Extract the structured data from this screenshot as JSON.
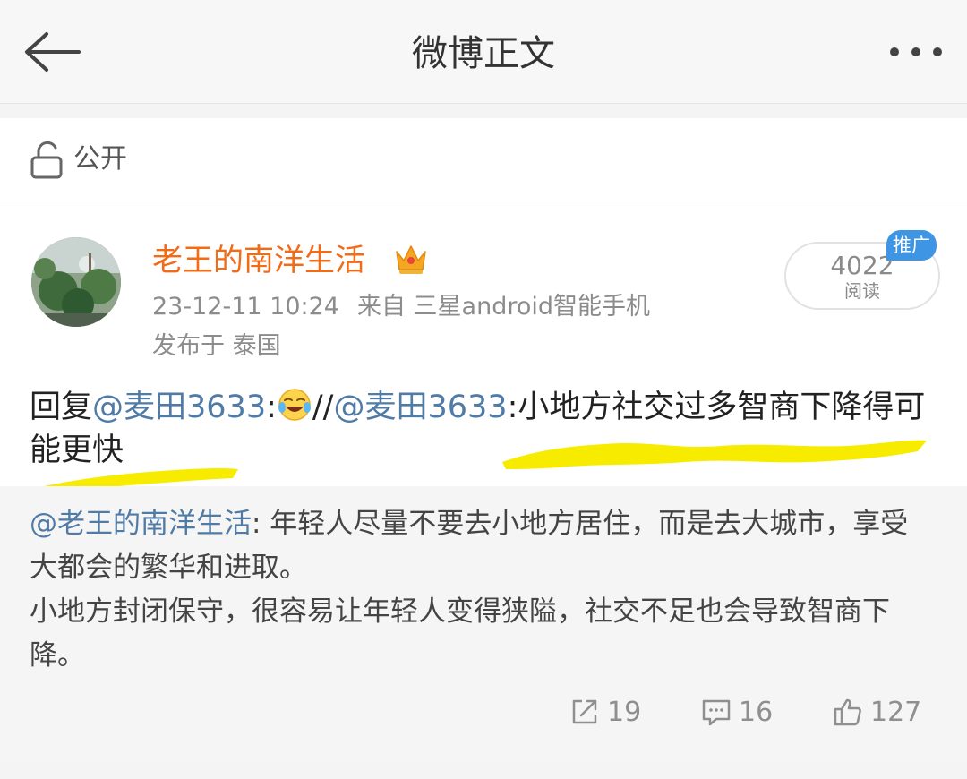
{
  "header": {
    "title": "微博正文",
    "back_icon": "back-arrow-icon",
    "more_icon": "more-dots-icon"
  },
  "privacy": {
    "icon": "lock-icon",
    "label": "公开"
  },
  "post": {
    "author": "老王的南洋生活",
    "author_badge_icon": "crown-icon",
    "author_color": "#f26b16",
    "timestamp": "23-12-11 10:24",
    "source": "来自 三星android智能手机",
    "location": "发布于 泰国",
    "read_count": "4022",
    "read_label": "阅读",
    "ad_badge": "推广",
    "text": {
      "prefix": "回复",
      "mention_1": "@麦田3633",
      "sep_1": ":",
      "emoji": "laughing-crying-emoji",
      "sep_2": "//",
      "mention_2": "@麦田3633",
      "body": ":小地方社交过多智商下降得可能更快"
    },
    "highlight_color": "#f7ec00",
    "mention_color": "#4f7ba6"
  },
  "quoted": {
    "mention": "@老王的南洋生活",
    "line1": ": 年轻人尽量不要去小地方居住，而是去大城市，享受大都会的繁华和进取。",
    "line2": "小地方封闭保守，很容易让年轻人变得狭隘，社交不足也会导致智商下降。"
  },
  "actions": {
    "repost_count": "19",
    "comment_count": "16",
    "like_count": "127",
    "repost_icon": "share-icon",
    "comment_icon": "comment-icon",
    "like_icon": "thumbs-up-icon"
  }
}
